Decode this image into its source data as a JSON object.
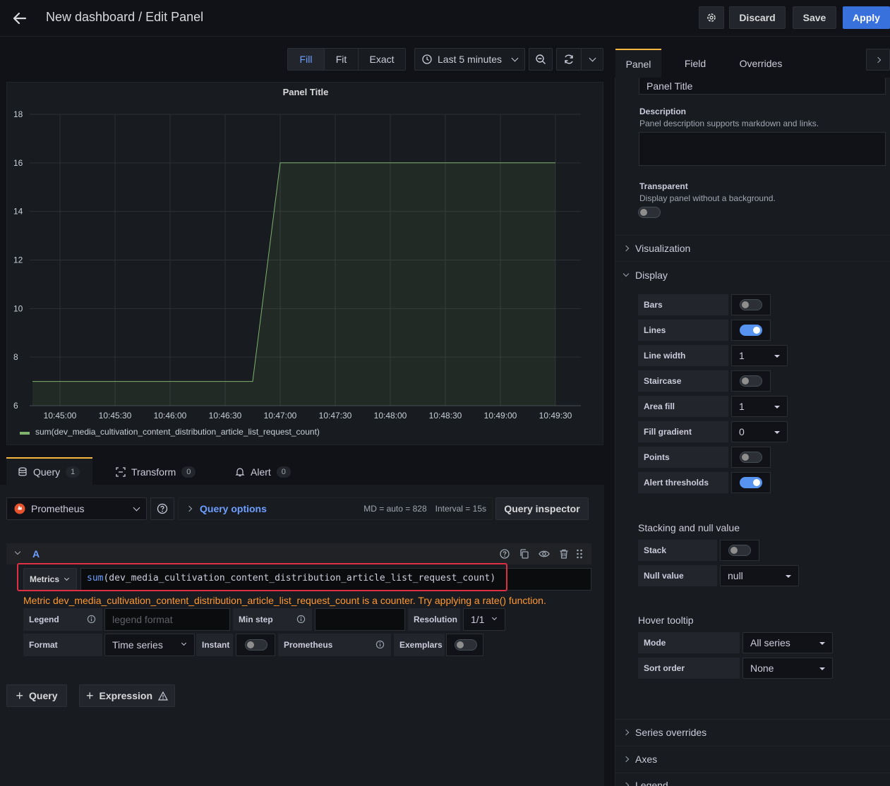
{
  "header": {
    "title": "New dashboard / Edit Panel",
    "discard": "Discard",
    "save": "Save",
    "apply": "Apply"
  },
  "toolbar": {
    "fill": "Fill",
    "fit": "Fit",
    "exact": "Exact",
    "time_range": "Last 5 minutes"
  },
  "panel": {
    "title": "Panel Title",
    "legend": "sum(dev_media_cultivation_content_distribution_article_list_request_count)"
  },
  "chart_data": {
    "type": "area",
    "title": "Panel Title",
    "x": [
      "10:45:00",
      "10:45:30",
      "10:46:00",
      "10:46:30",
      "10:47:00",
      "10:47:30",
      "10:48:00",
      "10:48:30",
      "10:49:00",
      "10:49:30"
    ],
    "yticks": [
      6,
      8,
      10,
      12,
      14,
      16,
      18
    ],
    "ylim": [
      6,
      18
    ],
    "grid": true,
    "legend_position": "bottom-left",
    "series": [
      {
        "name": "sum(dev_media_cultivation_content_distribution_article_list_request_count)",
        "color": "#7eb26d",
        "points": [
          [
            "10:44:45",
            7
          ],
          [
            "10:46:45",
            7
          ],
          [
            "10:47:00",
            16
          ],
          [
            "10:49:30",
            16
          ]
        ]
      }
    ]
  },
  "query_tabs": [
    {
      "label": "Query",
      "count": "1"
    },
    {
      "label": "Transform",
      "count": "0"
    },
    {
      "label": "Alert",
      "count": "0"
    }
  ],
  "query": {
    "datasource": "Prometheus",
    "options_label": "Query options",
    "md": "MD = auto = 828",
    "interval": "Interval = 15s",
    "inspector": "Query inspector",
    "ref": "A",
    "metrics_label": "Metrics",
    "expr_fn": "sum",
    "expr_arg": "(dev_media_cultivation_content_distribution_article_list_request_count)",
    "warning": "Metric dev_media_cultivation_content_distribution_article_list_request_count is a counter. Try applying a rate() function.",
    "legend_label": "Legend",
    "legend_placeholder": "legend format",
    "minstep_label": "Min step",
    "resolution_label": "Resolution",
    "resolution_value": "1/1",
    "format_label": "Format",
    "format_value": "Time series",
    "instant_label": "Instant",
    "prom_label": "Prometheus",
    "exemplars_label": "Exemplars",
    "add_query": "Query",
    "add_expression": "Expression"
  },
  "sidebar": {
    "tabs": [
      "Panel",
      "Field",
      "Overrides"
    ],
    "title_value": "Panel Title",
    "description_label": "Description",
    "description_help": "Panel description supports markdown and links.",
    "transparent_label": "Transparent",
    "transparent_help": "Display panel without a background.",
    "visualization": "Visualization",
    "display": "Display",
    "display_rows": [
      {
        "label": "Bars",
        "kind": "switch",
        "on": false
      },
      {
        "label": "Lines",
        "kind": "switch",
        "on": true
      },
      {
        "label": "Line width",
        "kind": "select",
        "value": "1"
      },
      {
        "label": "Staircase",
        "kind": "switch",
        "on": false
      },
      {
        "label": "Area fill",
        "kind": "select",
        "value": "1"
      },
      {
        "label": "Fill gradient",
        "kind": "select",
        "value": "0"
      },
      {
        "label": "Points",
        "kind": "switch",
        "on": false
      },
      {
        "label": "Alert thresholds",
        "kind": "switch",
        "on": true
      }
    ],
    "stacking_title": "Stacking and null value",
    "stack_label": "Stack",
    "null_label": "Null value",
    "null_value": "null",
    "hover_title": "Hover tooltip",
    "mode_label": "Mode",
    "mode_value": "All series",
    "sort_label": "Sort order",
    "sort_value": "None",
    "series_overrides": "Series overrides",
    "axes": "Axes",
    "legend": "Legend"
  },
  "colors": {
    "accent": "#3871dc",
    "series": "#7eb26d",
    "warning": "#ff9830",
    "highlight": "#e02f44",
    "link": "#6e9fff"
  }
}
